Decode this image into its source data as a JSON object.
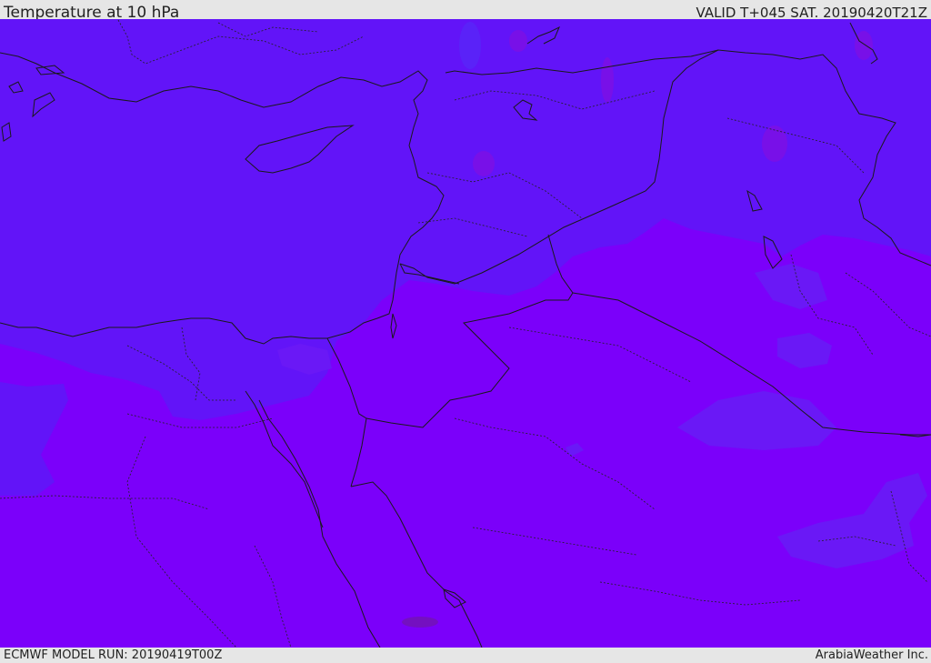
{
  "header": {
    "title": "Temperature at 10 hPa",
    "valid": "VALID T+045 SAT. 20190420T21Z"
  },
  "footer": {
    "model_run": "ECMWF MODEL RUN: 20190419T00Z",
    "brand": "ArabiaWeather Inc."
  },
  "map": {
    "colors": {
      "background": "#7b00fa",
      "cold_band": "#6214f8",
      "warm_patch": "#8a10e6",
      "dark_patch": "#7410c0",
      "coast": "#1a1a1a"
    }
  }
}
